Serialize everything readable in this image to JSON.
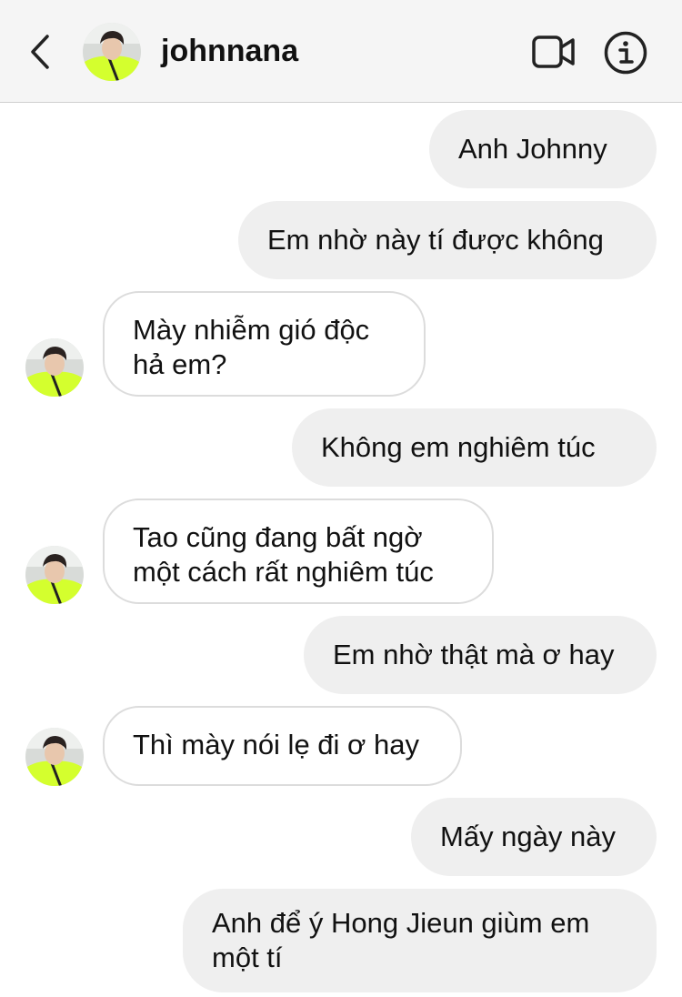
{
  "header": {
    "username": "johnnana",
    "back_icon": "chevron-left-icon",
    "video_icon": "video-camera-icon",
    "info_icon": "info-icon"
  },
  "colors": {
    "header_bg": "#f5f5f5",
    "sent_bubble": "#efefef",
    "received_border": "#dcdcdc",
    "avatar_shirt": "#d4ff2e"
  },
  "messages": [
    {
      "side": "sent",
      "text": "Anh Johnny"
    },
    {
      "side": "sent",
      "text": "Em nhờ này tí được không"
    },
    {
      "side": "received",
      "text": "Mày nhiễm gió độc\nhả em?"
    },
    {
      "side": "sent",
      "text": "Không em nghiêm túc"
    },
    {
      "side": "received",
      "text": "Tao cũng đang bất ngờ\nmột cách rất nghiêm túc"
    },
    {
      "side": "sent",
      "text": "Em nhờ thật mà ơ hay"
    },
    {
      "side": "received",
      "text": "Thì mày nói lẹ đi ơ hay"
    },
    {
      "side": "sent",
      "text": "Mấy ngày này"
    },
    {
      "side": "sent",
      "text": "Anh để ý Hong Jieun giùm em\nmột tí"
    }
  ]
}
